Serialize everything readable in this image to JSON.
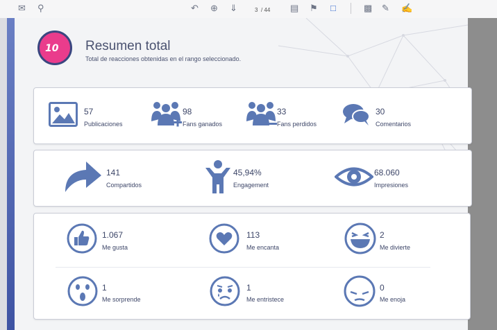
{
  "toolbar": {
    "page_current": "3",
    "page_total": "/ 44"
  },
  "header": {
    "logo_text": "10",
    "title": "Resumen total",
    "subtitle": "Total de reacciones obtenidas en el rango seleccionado."
  },
  "stats_row1": [
    {
      "value": "57",
      "label": "Publicaciones",
      "icon": "image-icon"
    },
    {
      "value": "98",
      "label": "Fans ganados",
      "icon": "fans-gained-icon"
    },
    {
      "value": "33",
      "label": "Fans perdidos",
      "icon": "fans-lost-icon"
    },
    {
      "value": "30",
      "label": "Comentarios",
      "icon": "comments-icon"
    }
  ],
  "stats_row2": [
    {
      "value": "141",
      "label": "Compartidos",
      "icon": "share-arrow-icon"
    },
    {
      "value": "45,94%",
      "label": "Engagement",
      "icon": "person-icon"
    },
    {
      "value": "68.060",
      "label": "Impresiones",
      "icon": "eye-icon"
    }
  ],
  "reactions": [
    {
      "value": "1.067",
      "label": "Me gusta",
      "icon": "thumbs-up-icon"
    },
    {
      "value": "113",
      "label": "Me encanta",
      "icon": "heart-icon"
    },
    {
      "value": "2",
      "label": "Me divierte",
      "icon": "laughing-face-icon"
    },
    {
      "value": "1",
      "label": "Me sorprende",
      "icon": "surprised-face-icon"
    },
    {
      "value": "1",
      "label": "Me entristece",
      "icon": "sad-face-icon"
    },
    {
      "value": "0",
      "label": "Me enoja",
      "icon": "angry-face-icon"
    }
  ],
  "colors": {
    "accent_blue": "#5b78b4",
    "logo_pink": "#ea3c8c",
    "text_dark": "#3e4769"
  }
}
